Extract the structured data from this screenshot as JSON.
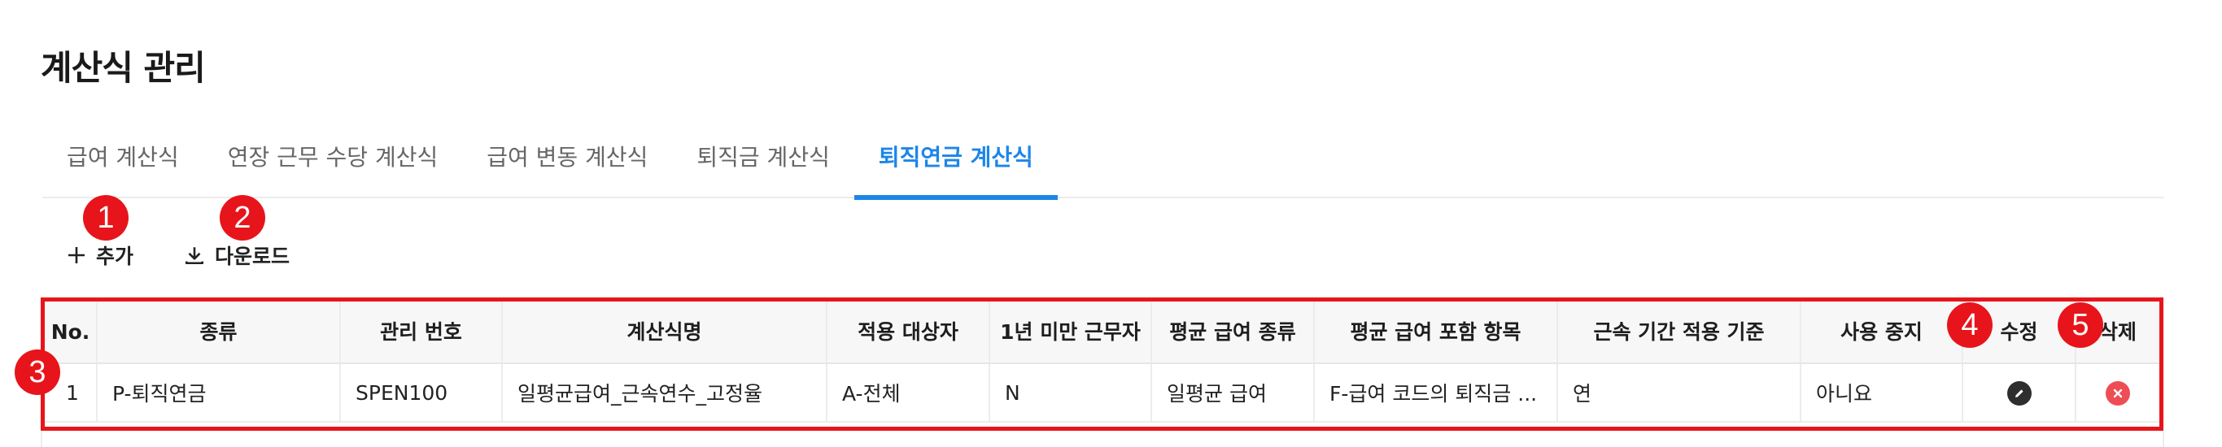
{
  "page": {
    "title": "계산식 관리"
  },
  "tabs": [
    {
      "label": "급여 계산식"
    },
    {
      "label": "연장 근무 수당 계산식"
    },
    {
      "label": "급여 변동 계산식"
    },
    {
      "label": "퇴직금 계산식"
    },
    {
      "label": "퇴직연금 계산식",
      "active": true
    }
  ],
  "toolbar": {
    "add_label": "추가",
    "download_label": "다운로드"
  },
  "markers": {
    "m1": "1",
    "m2": "2",
    "m3": "3",
    "m4": "4",
    "m5": "5"
  },
  "table": {
    "columns": [
      "No.",
      "종류",
      "관리 번호",
      "계산식명",
      "적용 대상자",
      "1년 미만 근무자",
      "평균 급여 종류",
      "평균 급여 포함 항목",
      "근속 기간 적용 기준",
      "사용 중지",
      "수정",
      "삭제"
    ],
    "rows": [
      {
        "no": "1",
        "type": "P-퇴직연금",
        "code": "SPEN100",
        "name": "일평균급여_근속연수_고정율",
        "target": "A-전체",
        "under_one_year": "N",
        "avg_pay_type": "일평균 급여",
        "avg_pay_items": "F-급여 코드의 퇴직금 ...",
        "service_basis": "연",
        "suspended": "아니요"
      }
    ]
  },
  "colors": {
    "accent": "#1c86e8",
    "marker": "#e8141b",
    "delete": "#ee4d55",
    "edit": "#2e2e2e"
  },
  "icons": {
    "add": "plus-icon",
    "download": "download-icon",
    "edit": "pencil-icon",
    "delete": "close-circle-icon"
  }
}
